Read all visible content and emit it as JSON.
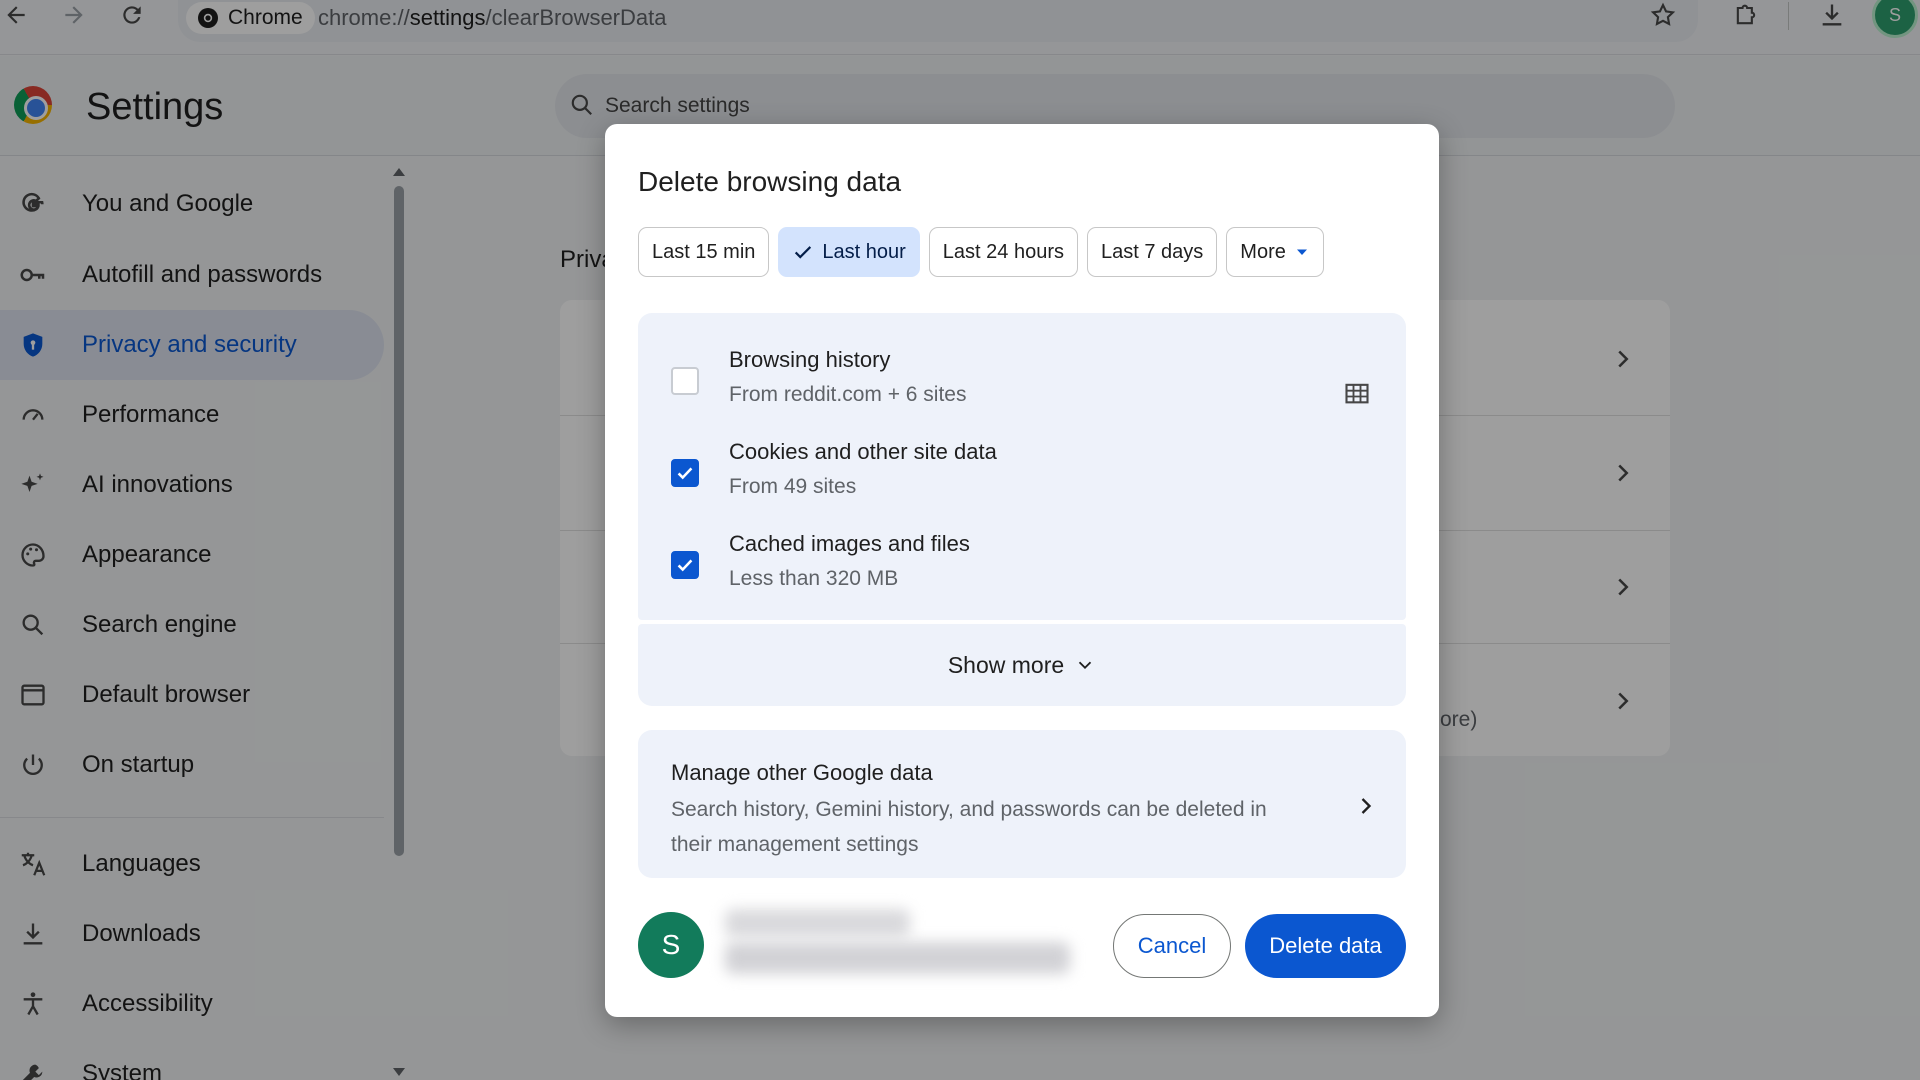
{
  "browser": {
    "chip_label": "Chrome",
    "url_prefix": "chrome://",
    "url_host": "settings",
    "url_path": "/clearBrowserData",
    "profile_initial": "S"
  },
  "settings": {
    "title": "Settings",
    "search_placeholder": "Search settings"
  },
  "sidebar": {
    "items": [
      {
        "label": "You and Google",
        "icon": "google-g-icon"
      },
      {
        "label": "Autofill and passwords",
        "icon": "key-icon"
      },
      {
        "label": "Privacy and security",
        "icon": "shield-icon",
        "active": true
      },
      {
        "label": "Performance",
        "icon": "speedometer-icon"
      },
      {
        "label": "AI innovations",
        "icon": "sparkle-icon"
      },
      {
        "label": "Appearance",
        "icon": "palette-icon"
      },
      {
        "label": "Search engine",
        "icon": "search-icon"
      },
      {
        "label": "Default browser",
        "icon": "browser-window-icon"
      },
      {
        "label": "On startup",
        "icon": "power-icon"
      },
      {
        "label": "Languages",
        "icon": "translate-icon"
      },
      {
        "label": "Downloads",
        "icon": "download-icon"
      },
      {
        "label": "Accessibility",
        "icon": "accessibility-icon"
      },
      {
        "label": "System",
        "icon": "wrench-icon"
      }
    ]
  },
  "background": {
    "section_heading": "Priva",
    "partial_text": "ore)"
  },
  "dialog": {
    "title": "Delete browsing data",
    "time_ranges": [
      {
        "label": "Last 15 min",
        "selected": false
      },
      {
        "label": "Last hour",
        "selected": true
      },
      {
        "label": "Last 24 hours",
        "selected": false
      },
      {
        "label": "Last 7 days",
        "selected": false
      },
      {
        "label": "More",
        "selected": false
      }
    ],
    "items": [
      {
        "title": "Browsing history",
        "subtitle": "From reddit.com + 6 sites",
        "checked": false
      },
      {
        "title": "Cookies and other site data",
        "subtitle": "From 49 sites",
        "checked": true
      },
      {
        "title": "Cached images and files",
        "subtitle": "Less than 320 MB",
        "checked": true
      }
    ],
    "show_more_label": "Show more",
    "manage": {
      "title": "Manage other Google data",
      "description": "Search history, Gemini history, and passwords can be deleted in their management settings"
    },
    "account_initial": "S",
    "cancel_label": "Cancel",
    "delete_label": "Delete data"
  },
  "colors": {
    "accent": "#0b57d0",
    "selected_chip_bg": "#d3e3fd",
    "card_bg": "#eef2fa",
    "avatar_bg": "#127b5b"
  }
}
